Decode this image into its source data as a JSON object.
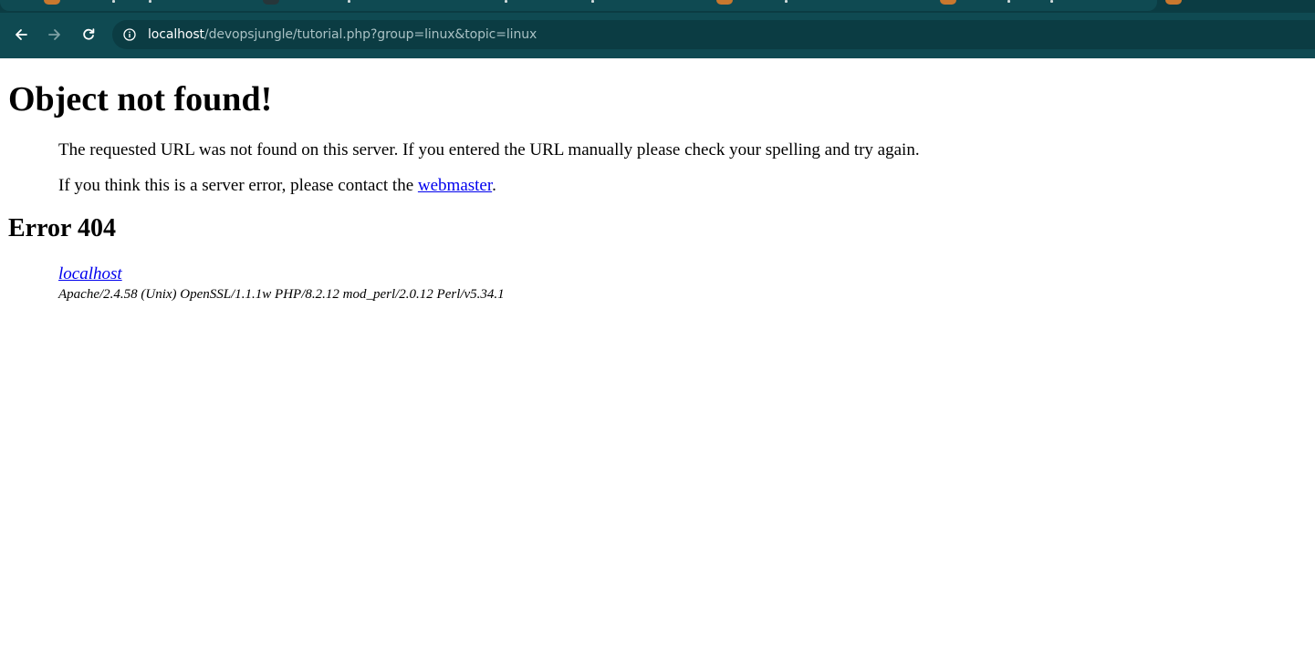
{
  "browser": {
    "url_host": "localhost",
    "url_path": "/devopsjungle/tutorial.php?group=linux&topic=linux",
    "icons": {
      "back": "arrow-left-icon",
      "forward": "arrow-right-icon",
      "reload": "reload-icon",
      "site_info": "info-icon"
    },
    "colors": {
      "chrome": "#0f4a52",
      "omnibox": "#0b3c43"
    }
  },
  "page": {
    "title": "Object not found!",
    "paragraph1": "The requested URL was not found on this server. If you entered the URL manually please check your spelling and try again.",
    "paragraph2_prefix": "If you think this is a server error, please contact the ",
    "paragraph2_link": "webmaster",
    "paragraph2_suffix": ".",
    "error_heading": "Error 404",
    "address_host": "localhost",
    "server_signature": "Apache/2.4.58 (Unix) OpenSSL/1.1.1w PHP/8.2.12 mod_perl/2.0.12 Perl/v5.34.1",
    "link_color": "#0000ee"
  }
}
